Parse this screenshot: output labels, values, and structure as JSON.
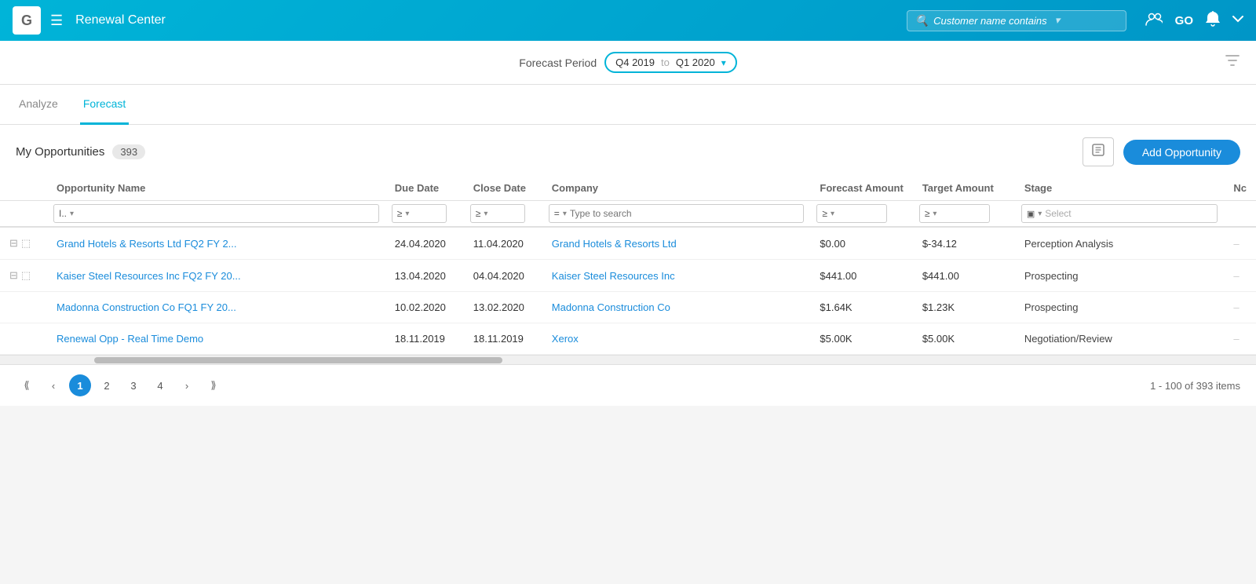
{
  "header": {
    "logo": "G",
    "title": "Renewal Center",
    "search_placeholder": "Customer name contains",
    "go_label": "GO",
    "icons": {
      "menu": "☰",
      "team": "👥",
      "bell": "🔔",
      "chevron": "⌄"
    }
  },
  "forecast_period": {
    "label": "Forecast Period",
    "start": "Q4 2019",
    "to": "to",
    "end": "Q1 2020"
  },
  "tabs": [
    {
      "id": "analyze",
      "label": "Analyze",
      "active": false
    },
    {
      "id": "forecast",
      "label": "Forecast",
      "active": true
    }
  ],
  "toolbar": {
    "my_opportunities_label": "My Opportunities",
    "count": "393",
    "add_button_label": "Add Opportunity"
  },
  "table": {
    "columns": [
      {
        "id": "actions",
        "label": ""
      },
      {
        "id": "name",
        "label": "Opportunity Name"
      },
      {
        "id": "due",
        "label": "Due Date"
      },
      {
        "id": "close",
        "label": "Close Date"
      },
      {
        "id": "company",
        "label": "Company"
      },
      {
        "id": "forecast",
        "label": "Forecast Amount"
      },
      {
        "id": "target",
        "label": "Target Amount"
      },
      {
        "id": "stage",
        "label": "Stage"
      },
      {
        "id": "nc",
        "label": "Nc"
      }
    ],
    "filters": {
      "name_filter": "I..",
      "company_placeholder": "Type to search",
      "stage_placeholder": "Select"
    },
    "rows": [
      {
        "id": 1,
        "name": "Grand Hotels & Resorts Ltd FQ2 FY 2...",
        "due_date": "24.04.2020",
        "close_date": "11.04.2020",
        "company": "Grand Hotels & Resorts Ltd",
        "forecast_amount": "$0.00",
        "target_amount": "$-34.12",
        "stage": "Perception Analysis",
        "nc": "–"
      },
      {
        "id": 2,
        "name": "Kaiser Steel Resources Inc FQ2 FY 20...",
        "due_date": "13.04.2020",
        "close_date": "04.04.2020",
        "company": "Kaiser Steel Resources Inc",
        "forecast_amount": "$441.00",
        "target_amount": "$441.00",
        "stage": "Prospecting",
        "nc": "–"
      },
      {
        "id": 3,
        "name": "Madonna Construction Co FQ1 FY 20...",
        "due_date": "10.02.2020",
        "close_date": "13.02.2020",
        "company": "Madonna Construction Co",
        "forecast_amount": "$1.64K",
        "target_amount": "$1.23K",
        "stage": "Prospecting",
        "nc": "–"
      },
      {
        "id": 4,
        "name": "Renewal Opp - Real Time Demo",
        "due_date": "18.11.2019",
        "close_date": "18.11.2019",
        "company": "Xerox",
        "forecast_amount": "$5.00K",
        "target_amount": "$5.00K",
        "stage": "Negotiation/Review",
        "nc": "–"
      }
    ]
  },
  "pagination": {
    "current": 1,
    "pages": [
      "1",
      "2",
      "3",
      "4"
    ],
    "info": "1 - 100 of 393 items"
  }
}
